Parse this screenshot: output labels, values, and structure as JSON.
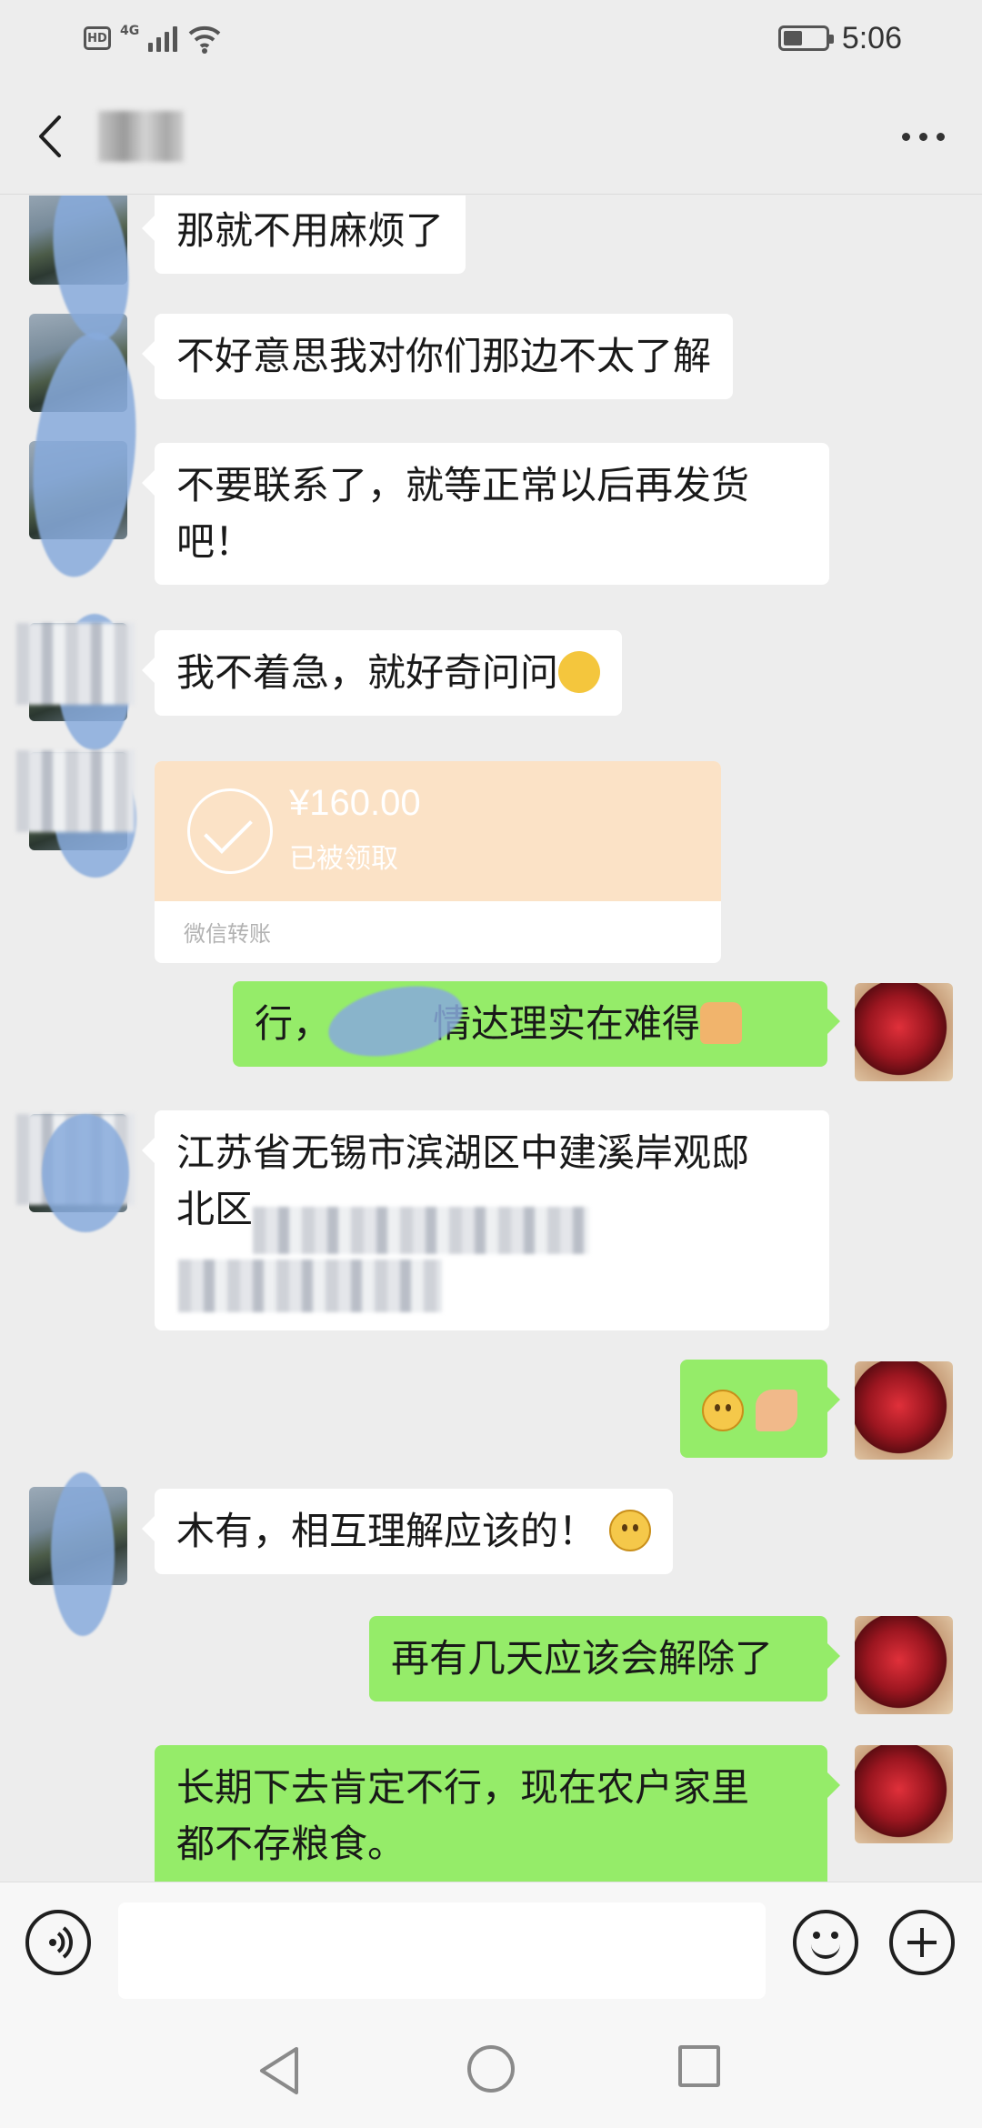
{
  "status_bar": {
    "hd_label": "HD",
    "network_label": "4G",
    "signal_level": 0.8,
    "battery_level": 0.45,
    "time": "5:06"
  },
  "title_bar": {
    "back_icon": "chevron-left-icon",
    "contact_name": "",
    "more_icon": "more-dots-icon"
  },
  "messages": [
    {
      "side": "in",
      "text": "那就不用麻烦了"
    },
    {
      "side": "in",
      "text": "不好意思我对你们那边不太了解"
    },
    {
      "side": "in",
      "text": "不要联系了，就等正常以后再发货\n吧！"
    },
    {
      "side": "in",
      "text": "我不着急，就好奇问问",
      "emoji": "laugh-cry-emoji"
    },
    {
      "side": "in",
      "type": "transfer",
      "amount": "¥160.00",
      "status": "已被领取",
      "label": "微信转账"
    },
    {
      "side": "out",
      "text_before": "行，",
      "text_after": "情达理实在难得",
      "emoji": "thumbs-up-emoji"
    },
    {
      "side": "in",
      "text_line1": "江苏省无锡市滨湖区中建溪岸观邸",
      "text_line2": "北区"
    },
    {
      "side": "out",
      "emojis": [
        "smile-emoji",
        "ok-hand-emoji"
      ]
    },
    {
      "side": "in",
      "text": "木有，相互理解应该的！",
      "emoji": "smile-emoji"
    },
    {
      "side": "out",
      "text": "再有几天应该会解除了"
    },
    {
      "side": "out",
      "text": "长期下去肯定不行，现在农户家里\n都不存粮食。"
    }
  ],
  "input_bar": {
    "voice_icon": "voice-icon",
    "input_value": "",
    "emoji_icon": "emoji-icon",
    "plus_icon": "plus-icon"
  },
  "nav_bar": {
    "back_icon": "nav-back-icon",
    "home_icon": "nav-home-icon",
    "recent_icon": "nav-recent-icon"
  },
  "colors": {
    "background": "#ededed",
    "incoming_bubble": "#ffffff",
    "outgoing_bubble": "#95ec69",
    "transfer_card": "#fbe2c6"
  }
}
